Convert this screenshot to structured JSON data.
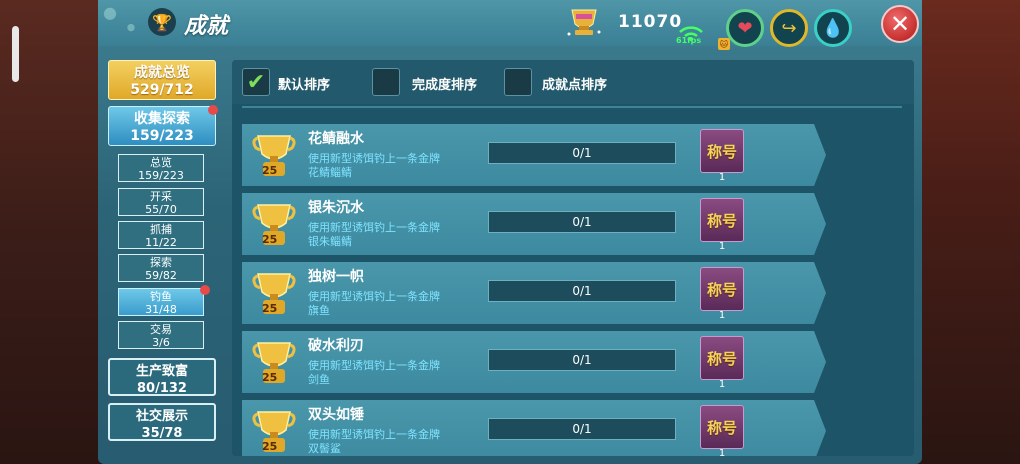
{
  "header": {
    "title": "成就",
    "coins": "11070",
    "fps": "61fps"
  },
  "menu": {
    "summary": {
      "label": "成就总览",
      "count": "529/712"
    },
    "collect": {
      "label": "收集探索",
      "count": "159/223"
    },
    "sub": [
      {
        "label": "总览",
        "count": "159/223"
      },
      {
        "label": "开采",
        "count": "55/70"
      },
      {
        "label": "抓捕",
        "count": "11/22"
      },
      {
        "label": "探索",
        "count": "59/82"
      },
      {
        "label": "钓鱼",
        "count": "31/48"
      },
      {
        "label": "交易",
        "count": "3/6"
      }
    ],
    "produce": {
      "label": "生产致富",
      "count": "80/132"
    },
    "social": {
      "label": "社交展示",
      "count": "35/78"
    }
  },
  "sort": {
    "default": "默认排序",
    "completion": "完成度排序",
    "points": "成就点排序"
  },
  "achievements": [
    {
      "title": "花鲭融水",
      "desc": "使用新型诱饵钓上一条金牌",
      "fish": "花鲭鲻鲭",
      "points": "25",
      "progress": "0/1",
      "reward": "称号",
      "reward_count": "1"
    },
    {
      "title": "银朱沉水",
      "desc": "使用新型诱饵钓上一条金牌",
      "fish": "银朱鲻鲭",
      "points": "25",
      "progress": "0/1",
      "reward": "称号",
      "reward_count": "1"
    },
    {
      "title": "独树一帜",
      "desc": "使用新型诱饵钓上一条金牌",
      "fish": "旗鱼",
      "points": "25",
      "progress": "0/1",
      "reward": "称号",
      "reward_count": "1"
    },
    {
      "title": "破水利刃",
      "desc": "使用新型诱饵钓上一条金牌",
      "fish": "剑鱼",
      "points": "25",
      "progress": "0/1",
      "reward": "称号",
      "reward_count": "1"
    },
    {
      "title": "双头如锤",
      "desc": "使用新型诱饵钓上一条金牌",
      "fish": "双髻鲨",
      "points": "25",
      "progress": "0/1",
      "reward": "称号",
      "reward_count": "1"
    }
  ]
}
